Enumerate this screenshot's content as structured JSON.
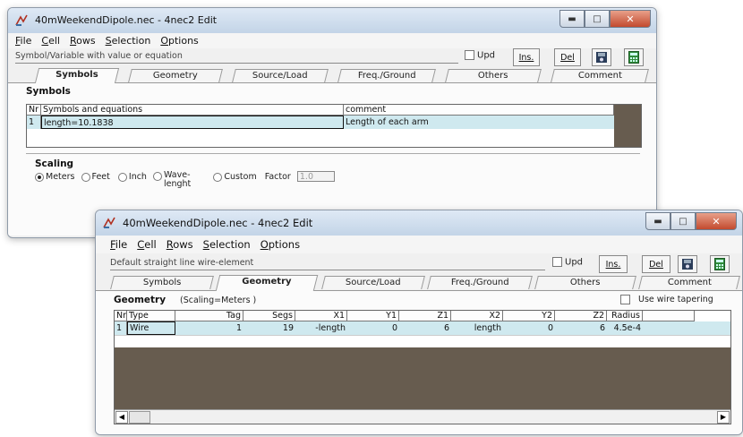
{
  "w1": {
    "title": "40mWeekendDipole.nec - 4nec2 Edit",
    "menu": [
      "File",
      "Cell",
      "Rows",
      "Selection",
      "Options"
    ],
    "hint": "Symbol/Variable with value or equation",
    "upd": "Upd",
    "ins": "Ins.",
    "del": "Del",
    "tabs": [
      "Symbols",
      "Geometry",
      "Source/Load",
      "Freq./Ground",
      "Others",
      "Comment"
    ],
    "section": "Symbols",
    "headers": {
      "nr": "Nr",
      "sym": "Symbols and equations",
      "comment": "comment"
    },
    "row": {
      "nr": "1",
      "sym": "length=10.1838",
      "comment": "Length of each arm"
    },
    "scaling": {
      "label": "Scaling",
      "options": [
        "Meters",
        "Feet",
        "Inch",
        "Wave-\nlenght",
        "Custom"
      ],
      "factor_label": "Factor",
      "factor_value": "1.0"
    }
  },
  "w2": {
    "title": "40mWeekendDipole.nec - 4nec2 Edit",
    "menu": [
      "File",
      "Cell",
      "Rows",
      "Selection",
      "Options"
    ],
    "hint": "Default straight line wire-element",
    "upd": "Upd",
    "ins": "Ins.",
    "del": "Del",
    "tabs": [
      "Symbols",
      "Geometry",
      "Source/Load",
      "Freq./Ground",
      "Others",
      "Comment"
    ],
    "section": "Geometry",
    "scaling_note": "(Scaling=Meters )",
    "taper": "Use wire tapering",
    "headers": [
      "Nr",
      "Type",
      "Tag",
      "Segs",
      "X1",
      "Y1",
      "Z1",
      "X2",
      "Y2",
      "Z2",
      "Radius"
    ],
    "row": [
      "1",
      "Wire",
      "1",
      "19",
      "-length",
      "0",
      "6",
      "length",
      "0",
      "6",
      "4.5e-4"
    ]
  },
  "colors": {
    "grid_empty": "#675c4f",
    "row_select": "#cfe9ef",
    "title_bar": "#c3d4e7"
  }
}
